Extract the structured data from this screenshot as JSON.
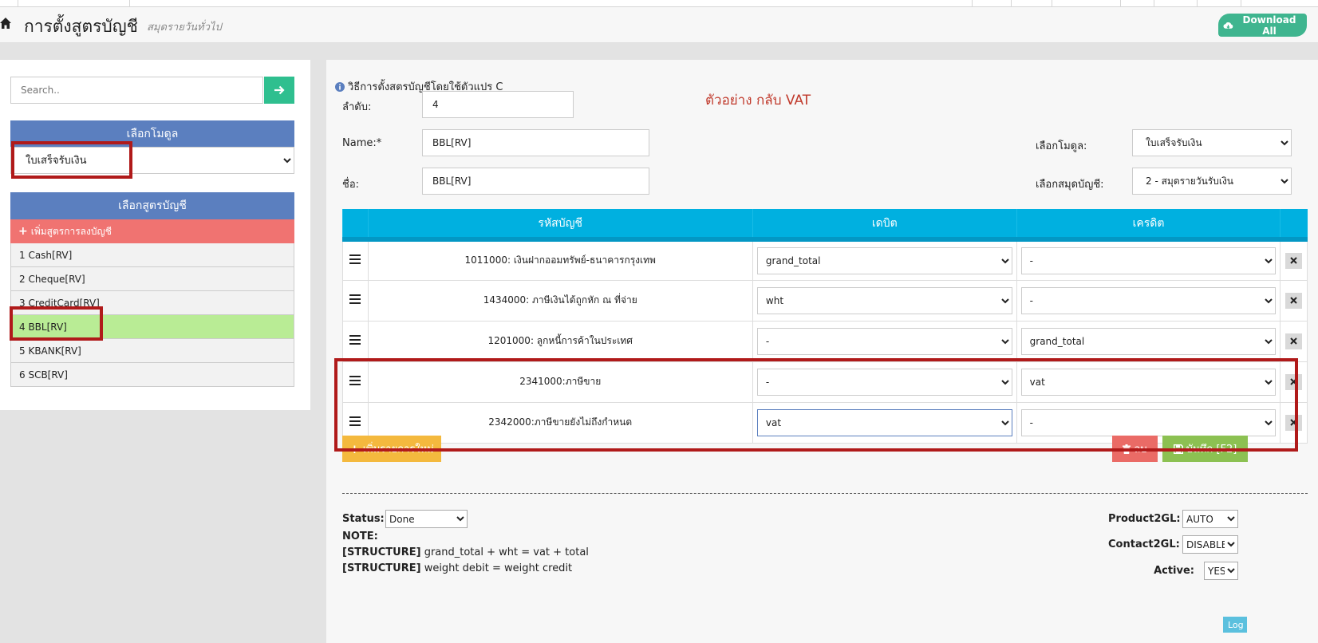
{
  "header": {
    "title": "การตั้งสูตรบัญชี",
    "subtitle": "สมุดรายวันทั่วไป",
    "download_label": "Download All"
  },
  "sidebar": {
    "search_placeholder": "Search..",
    "module_heading": "เลือกโมดูล",
    "module_selected": "ใบเสร็จรับเงิน",
    "formula_heading": "เลือกสูตรบัญชี",
    "add_formula_label": "เพิ่มสูตรการลงบัญชี",
    "formulas": [
      {
        "label": "1 Cash[RV]",
        "active": false
      },
      {
        "label": "2 Cheque[RV]",
        "active": false
      },
      {
        "label": "3 CreditCard[RV]",
        "active": false
      },
      {
        "label": "4 BBL[RV]",
        "active": true
      },
      {
        "label": "5 KBANK[RV]",
        "active": false
      },
      {
        "label": "6 SCB[RV]",
        "active": false
      }
    ]
  },
  "main": {
    "method_label": "วิธีการตั้งสตรบัญชีโดยใช้ตัวแปร C",
    "example_note": "ตัวอย่าง  กลับ VAT",
    "order_label": "ลำดับ:",
    "order_value": "4",
    "name_label": "Name:*",
    "name_value": "BBL[RV]",
    "thai_name_label": "ชื่อ:",
    "thai_name_value": "BBL[RV]",
    "module_label": "เลือกโมดูล:",
    "module_value": "ใบเสร็จรับเงิน",
    "book_label": "เลือกสมุดบัญชี:",
    "book_value": "2 - สมุดรายวันรับเงิน",
    "table": {
      "headers": [
        "รหัสบัญชี",
        "เดบิต",
        "เครดิต"
      ],
      "rows": [
        {
          "account": "1011000: เงินฝากออมทรัพย์-ธนาคารกรุงเทพ",
          "debit": "grand_total",
          "credit": "-"
        },
        {
          "account": "1434000: ภาษีเงินได้ถูกหัก ณ ที่จ่าย",
          "debit": "wht",
          "credit": "-"
        },
        {
          "account": "1201000: ลูกหนี้การค้าในประเทศ",
          "debit": "-",
          "credit": "grand_total"
        },
        {
          "account": "2341000:ภาษีขาย",
          "debit": "-",
          "credit": "vat"
        },
        {
          "account": "2342000:ภาษีขายยังไม่ถึงกำหนด",
          "debit": "vat",
          "credit": "-"
        }
      ]
    },
    "add_row_label": "เพิ่มรายการใหม่",
    "delete_label": "ลบ",
    "save_label": "บันทึก [F2]",
    "status_label": "Status:",
    "status_value": "Done",
    "note_label": "NOTE:",
    "structure_tag": "[STRUCTURE]",
    "structure_1": "grand_total + wht = vat + total",
    "structure_2": "weight debit = weight credit",
    "product2gl_label": "Product2GL:",
    "product2gl_value": "AUTO",
    "contact2gl_label": "Contact2GL:",
    "contact2gl_value": "DISABLE",
    "active_label": "Active:",
    "active_value": "YES",
    "log_label": "Log"
  },
  "colors": {
    "accent_teal": "#3fb58f",
    "panel_blue": "#5b7fbf",
    "table_header": "#00b0e0",
    "add_formula_red": "#f07371",
    "active_green": "#b9ec95",
    "highlight_red": "#b01a1a"
  }
}
